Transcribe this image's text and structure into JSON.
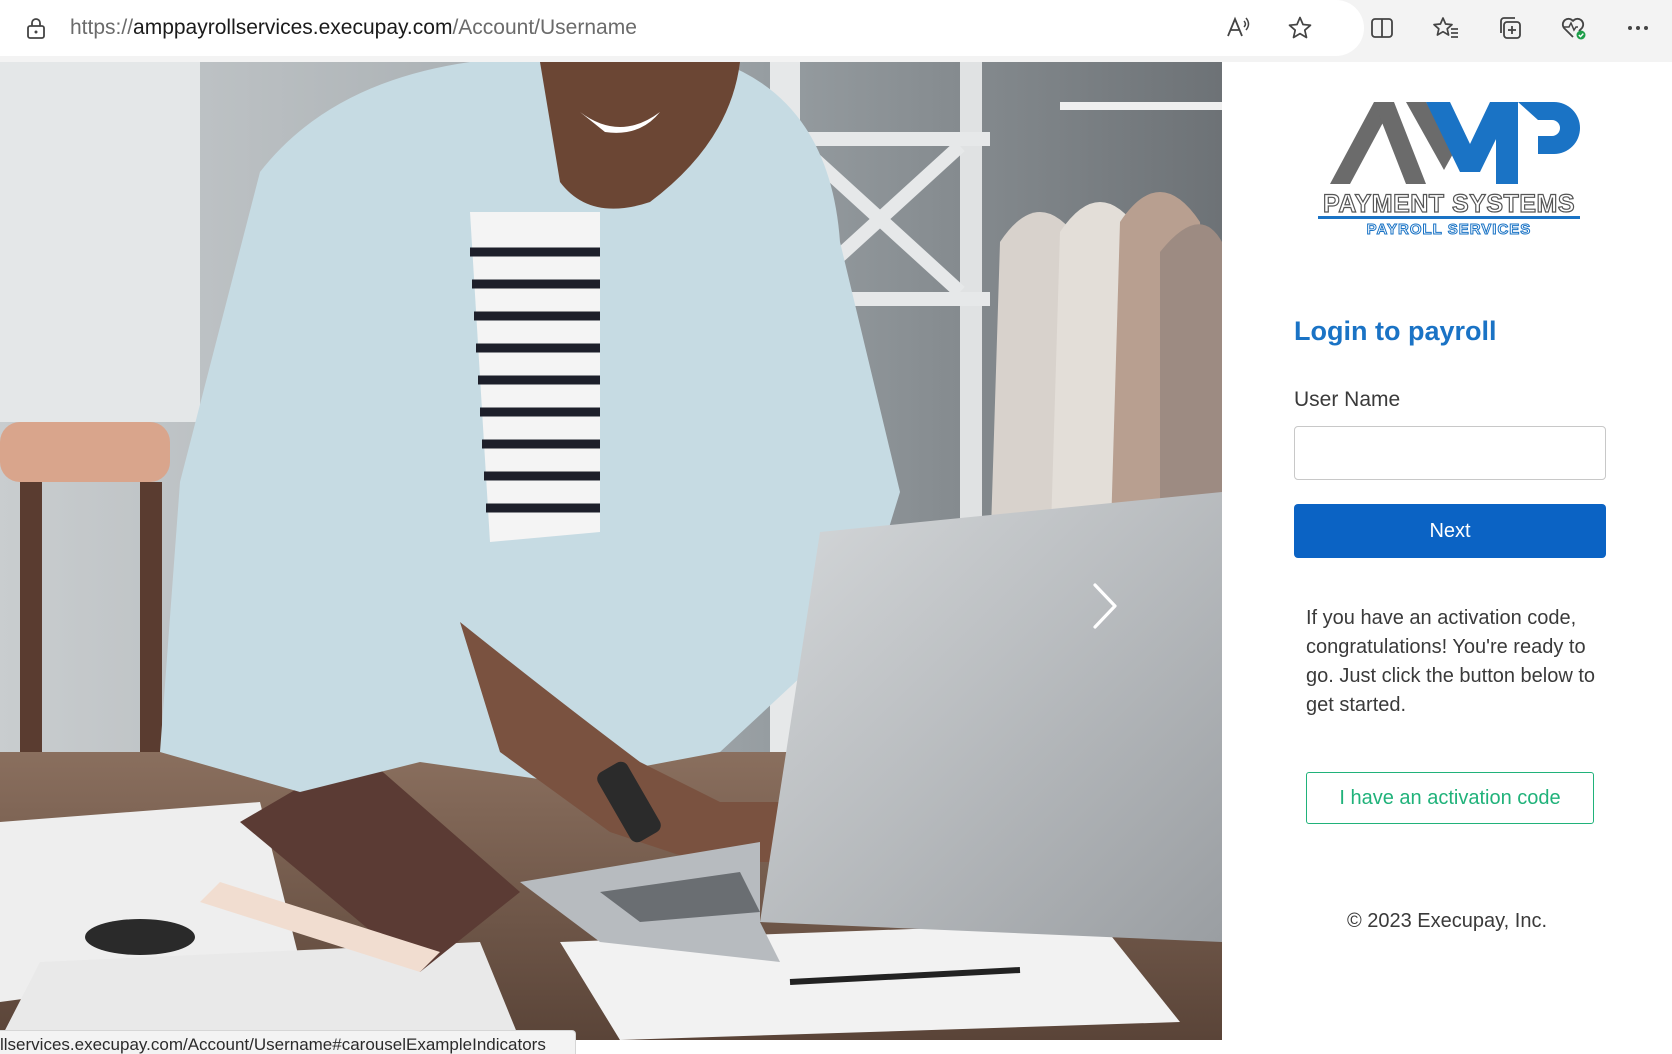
{
  "browser": {
    "url_prefix": "https://",
    "url_host": "amppayrollservices.execupay.com",
    "url_path": "/Account/Username",
    "toolbar_icons": [
      "lock-icon",
      "read-aloud-icon",
      "favorite-star-icon",
      "split-screen-icon",
      "favorites-icon",
      "collections-icon",
      "browser-essentials-icon",
      "more-icon"
    ]
  },
  "hero": {
    "next_icon": "chevron-right-icon"
  },
  "logo": {
    "mark": "AMP",
    "line1": "PAYMENT SYSTEMS",
    "line2": "PAYROLL SERVICES"
  },
  "login": {
    "title": "Login to payroll",
    "username_label": "User Name",
    "username_value": "",
    "next_label": "Next",
    "activation_text": "If you have an activation code, congratulations! You're ready to go. Just click the button below to get started.",
    "activation_button": "I have an activation code",
    "copyright": "© 2023 Execupay, Inc."
  },
  "status_bar": {
    "text": "llservices.execupay.com/Account/Username#carouselExampleIndicators"
  },
  "colors": {
    "title_blue": "#1a73c5",
    "button_blue": "#0b63c4",
    "activation_green": "#20b27a"
  }
}
